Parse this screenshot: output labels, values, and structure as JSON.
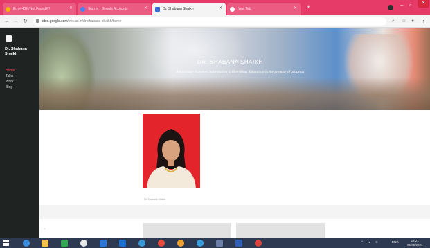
{
  "browser": {
    "tabs": [
      {
        "label": "Error 404 (Not Found)!!!",
        "favicon_color": "#f4b400",
        "active": false
      },
      {
        "label": "Sign in - Google Accounts",
        "favicon_color": "#4285f4",
        "active": false
      },
      {
        "label": "Dr. Shabana Shaikh",
        "favicon_color": "#3b6bd6",
        "active": true
      },
      {
        "label": "New Tab",
        "favicon_color": "#ffffff",
        "active": false
      }
    ],
    "new_tab_label": "+",
    "address": {
      "host": "sites.google.com",
      "path": "/ves.ac.in/dr-shabana-shaikh/home"
    },
    "accent_color": "#e63b68"
  },
  "site": {
    "title": "Dr. Shabana Shaikh",
    "nav": [
      {
        "label": "Home",
        "active": true
      },
      {
        "label": "Talks",
        "active": false
      },
      {
        "label": "Work",
        "active": false
      },
      {
        "label": "Blog",
        "active": false
      }
    ],
    "banner_title": "DR. SHABANA SHAIKH",
    "banner_quote": "Knowledge is power. Information is liberating. Education is the premise of progress",
    "photo_caption": "Dr. Shabana Shaikh"
  },
  "taskbar": {
    "apps": [
      {
        "icon": "internet-explorer-icon",
        "color": "#3b8fe0"
      },
      {
        "icon": "file-explorer-icon",
        "color": "#f2c14e"
      },
      {
        "icon": "store-icon",
        "color": "#2fa84f"
      },
      {
        "icon": "app-icon",
        "color": "#e8e8e8"
      },
      {
        "icon": "edge-icon",
        "color": "#2b78d8"
      },
      {
        "icon": "media-icon",
        "color": "#1c6fd1"
      },
      {
        "icon": "photos-icon",
        "color": "#3a9ad9"
      },
      {
        "icon": "chrome-icon",
        "color": "#e84b3c"
      },
      {
        "icon": "paint-icon",
        "color": "#f0a030"
      },
      {
        "icon": "network-icon",
        "color": "#39a0e0"
      },
      {
        "icon": "settings-icon",
        "color": "#6a7ea8"
      },
      {
        "icon": "word-icon",
        "color": "#2f5fb7"
      },
      {
        "icon": "chrome-icon",
        "color": "#d9453a"
      }
    ],
    "tray_text": "ENG",
    "clock_time": "14:21",
    "clock_date": "05/08/2021"
  }
}
